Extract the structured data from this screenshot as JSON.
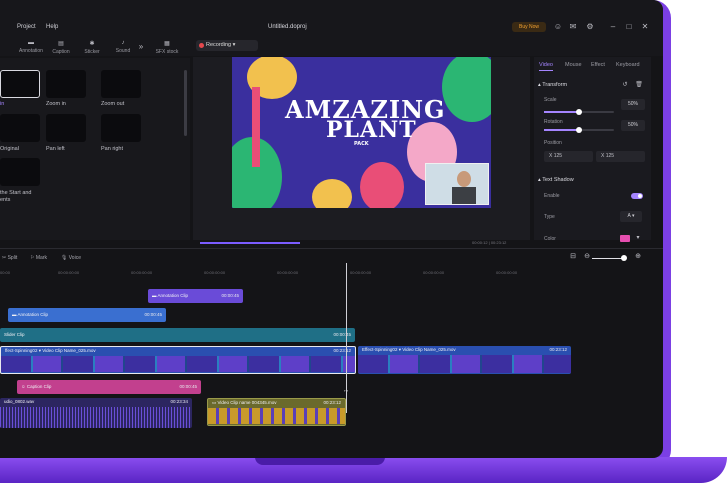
{
  "app": {
    "title": "Untitled.doproj",
    "menu": [
      "Project",
      "Help"
    ],
    "buy_now": "Buy Now"
  },
  "toolbar": {
    "tools": [
      "Annotation",
      "Caption",
      "Sticker",
      "Sound",
      "SFX stock"
    ],
    "recording": "Recording"
  },
  "left_panel": {
    "items": [
      {
        "label": "in"
      },
      {
        "label": "Zoom in"
      },
      {
        "label": "Zoom out"
      },
      {
        "label": "Original"
      },
      {
        "label": "Pan left"
      },
      {
        "label": "Pan right"
      },
      {
        "label": "the Start and"
      },
      {
        "label": "ents"
      }
    ]
  },
  "preview": {
    "title_line1": "AMZAZING",
    "title_line2": "PLANT",
    "subtitle": "PACK",
    "timecode": "00:00:12 | 00:23:12"
  },
  "right_panel": {
    "tabs": [
      "Video",
      "Mouse",
      "Effect",
      "Keyboard"
    ],
    "active_tab": "Video",
    "transform": {
      "heading": "Transform",
      "scale_label": "Scale",
      "scale_value": "50%",
      "scale_level": 0.5,
      "rotation_label": "Rotation",
      "rotation_value": "50%",
      "rotation_level": 0.5,
      "position_label": "Position",
      "x_value": "X  125",
      "y_value": "X  125"
    },
    "text_shadow": {
      "heading": "Text Shadow",
      "enable_label": "Enable",
      "enabled": true,
      "type_label": "Type",
      "type_value": "A",
      "color_label": "Color",
      "color_value": "#e64fb0"
    }
  },
  "timeline": {
    "tools": [
      "Split",
      "Mark",
      "Voice"
    ],
    "ruler": [
      "00:00",
      "00:00:00:00",
      "00:00:00:00",
      "00:00:00:00",
      "00:00:00:00",
      "00:00:00:00",
      "00:00:00:00",
      "00:00:00:00"
    ],
    "clips": {
      "annotation1": {
        "label": "Annotation Clip",
        "duration": "00:00:45"
      },
      "annotation2": {
        "label": "Annotation Clip",
        "duration": "00:00:45"
      },
      "slider": {
        "label": "Slider Clip",
        "duration": "00:00:45"
      },
      "video1": {
        "label": "ffect-Spinning02  ▾   Video Clip Name_025.mov",
        "duration": "00:23:12"
      },
      "video2": {
        "label": "Effect-Spinning02  ▾   Video Clip Name_025.mov",
        "duration": "00:23:12"
      },
      "caption": {
        "label": "Caption Clip",
        "duration": "00:00:45"
      },
      "audio": {
        "label": "udio_0802.wav",
        "duration": "00:23:34"
      },
      "video3": {
        "label": "Video Clip name 004345.mov",
        "duration": "00:23:12"
      }
    }
  },
  "colors": {
    "accent": "#a585ff",
    "laptop": "#7b3fe4",
    "annotation": "#6a4bd8",
    "slider": "#1f6f86",
    "caption": "#c2408e",
    "video": "#2a4fb0"
  }
}
